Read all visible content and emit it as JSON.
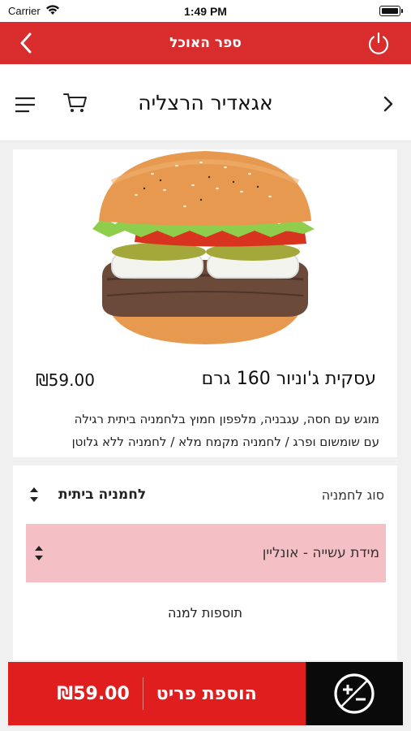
{
  "status_bar": {
    "carrier": "Carrier",
    "time": "1:49 PM"
  },
  "top_bar": {
    "title": "ספר האוכל"
  },
  "header": {
    "restaurant_name": "אגאדיר הרצליה"
  },
  "item": {
    "name": "עסקית ג'וניור 160 גרם",
    "price": "₪59.00",
    "description_line1": "מוגש עם חסה, עגבניה, מלפפון חמוץ בלחמניה ביתית רגילה",
    "description_line2": "עם שומשום ופרג / לחמניה מקמח מלא / לחמניה ללא גלוטן"
  },
  "options": {
    "bun_label": "סוג לחמניה",
    "bun_value": "לחמניה ביתית",
    "doneness_label": "מידת עשייה - אונליין",
    "extras_label": "תוספות למנה"
  },
  "bottom_bar": {
    "add_label": "הוספת פריט",
    "price": "₪59.00"
  },
  "colors": {
    "brand_red": "#d92c2c",
    "button_red": "#e01e1e",
    "highlight_pink": "#f5c0c5",
    "dark": "#0a0a0a"
  },
  "icons": [
    "wifi-icon",
    "battery-icon",
    "back-chevron-icon",
    "power-icon",
    "menu-icon",
    "cart-icon",
    "chevron-right-icon",
    "sort-updown-icon",
    "plus-minus-icon"
  ]
}
